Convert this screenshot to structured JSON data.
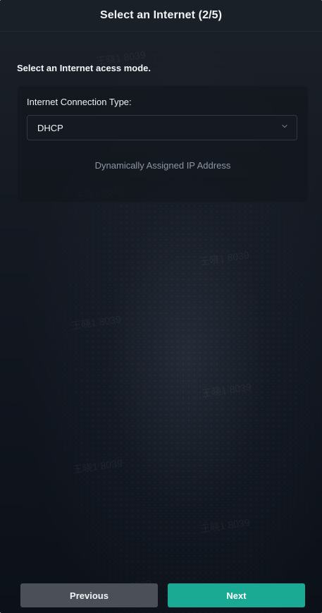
{
  "header": {
    "title": "Select an Internet (2/5)"
  },
  "page": {
    "section_title": "Select an Internet acess mode."
  },
  "connection_card": {
    "label": "Internet Connection Type:",
    "selected_value": "DHCP",
    "description": "Dynamically Assigned IP Address",
    "chevron_icon": "chevron-down-icon"
  },
  "footer": {
    "previous_label": "Previous",
    "next_label": "Next"
  },
  "watermarks": [
    "王晓1 8039",
    "王晓1 8039",
    "王晓1 8039",
    "王晓1 8039",
    "王晓1 8039",
    "王晓1 8039",
    "王晓1 8039",
    "王晓1 8039",
    "王晓1 8039"
  ],
  "colors": {
    "background": "#141922",
    "card": "#12161d",
    "accent": "#1aa992",
    "secondary_button": "#4a4f58",
    "muted_text": "#8d97a4"
  }
}
